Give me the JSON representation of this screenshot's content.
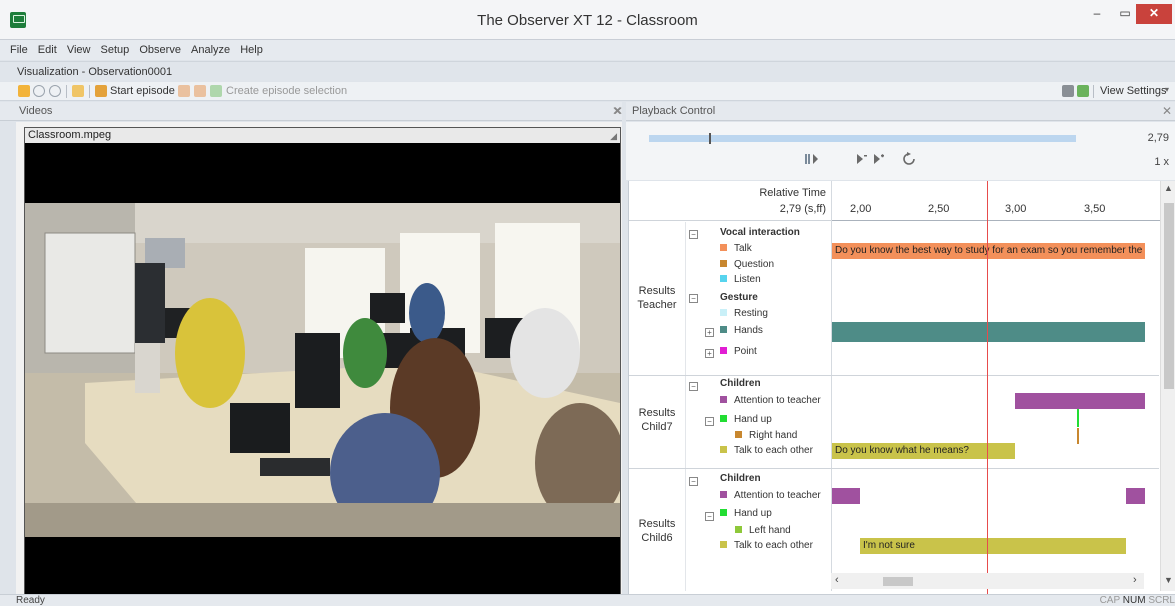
{
  "window": {
    "title": "The Observer XT 12 - Classroom",
    "min": "–",
    "max": "▭",
    "close": "✕"
  },
  "menu": [
    "File",
    "Edit",
    "View",
    "Setup",
    "Observe",
    "Analyze",
    "Help"
  ],
  "visualization_tab": "Visualization - Observation0001",
  "toolbar": {
    "start_episode": "Start episode",
    "create_selection": "Create episode selection",
    "view_settings": "View Settings"
  },
  "videos": {
    "header": "Videos",
    "file": "Classroom.mpeg"
  },
  "playback": {
    "header": "Playback Control",
    "time": "2,79",
    "speed": "1 x",
    "position_fraction": 0.14
  },
  "timeline": {
    "relative_time_label": "Relative Time",
    "relative_time_value": "2,79 (s,ff)",
    "ticks": [
      "2,00",
      "2,50",
      "3,00",
      "3,50"
    ],
    "groups": [
      {
        "label": "Results Teacher",
        "rows": [
          {
            "text": "Vocal interaction",
            "bold": true,
            "expander": "−"
          },
          {
            "text": "Talk",
            "color": "#f3905a"
          },
          {
            "text": "Question",
            "color": "#c8872f"
          },
          {
            "text": "Listen",
            "color": "#57d4ee"
          },
          {
            "text": "Gesture",
            "bold": true,
            "expander": "−"
          },
          {
            "text": "Resting",
            "color": "#c9f0f8"
          },
          {
            "text": "Hands",
            "color": "#4e8c87",
            "expander": "+"
          },
          {
            "text": "Point",
            "color": "#e11ed3",
            "expander": "+"
          }
        ],
        "bars": [
          {
            "text": "Do you know the best way to study for an exam so you remember the",
            "color": "#f3905a"
          },
          {
            "text": "",
            "color": "#4e8c87"
          }
        ]
      },
      {
        "label": "Results Child7",
        "rows": [
          {
            "text": "Children",
            "bold": true,
            "expander": "−"
          },
          {
            "text": "Attention to teacher",
            "color": "#a0519f"
          },
          {
            "text": "Hand up",
            "color": "#22dd33",
            "expander": "−"
          },
          {
            "text": "Right hand",
            "color": "#c8872f"
          },
          {
            "text": "Talk to each other",
            "color": "#c9c34a"
          }
        ],
        "bars": [
          {
            "text": "Do you know what he means?",
            "color": "#c9c34a"
          }
        ]
      },
      {
        "label": "Results Child6",
        "rows": [
          {
            "text": "Children",
            "bold": true,
            "expander": "−"
          },
          {
            "text": "Attention to teacher",
            "color": "#a0519f"
          },
          {
            "text": "Hand up",
            "color": "#22dd33",
            "expander": "−"
          },
          {
            "text": "Left hand",
            "color": "#8ec83a"
          },
          {
            "text": "Talk to each other",
            "color": "#c9c34a"
          }
        ],
        "bars": [
          {
            "text": "I'm not sure",
            "color": "#c9c34a"
          }
        ]
      }
    ]
  },
  "status": {
    "text": "Ready",
    "keys": [
      "CAP",
      "NUM",
      "SCRL"
    ]
  }
}
